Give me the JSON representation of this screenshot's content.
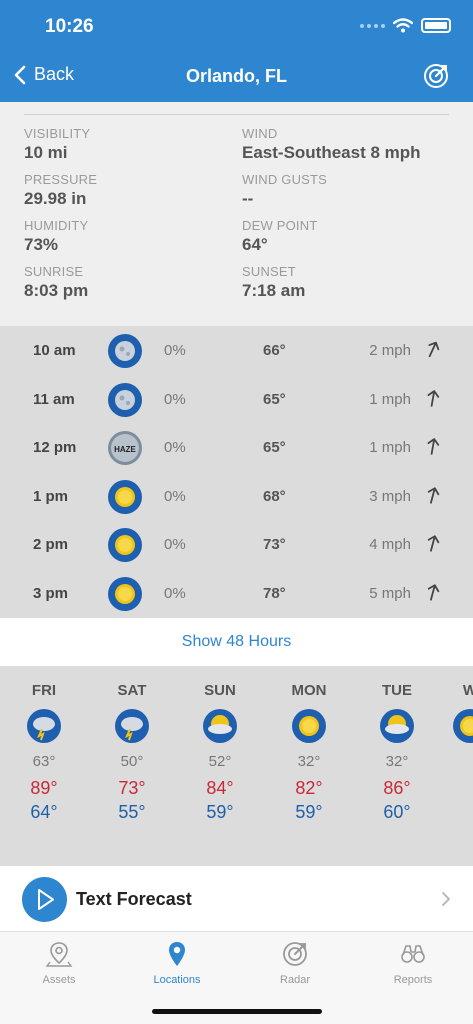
{
  "status_bar": {
    "time": "10:26"
  },
  "nav": {
    "back_label": "Back",
    "title": "Orlando, FL",
    "radar_icon": "radar-icon"
  },
  "details": {
    "visibility": {
      "label": "VISIBILITY",
      "value": "10 mi"
    },
    "wind": {
      "label": "WIND",
      "value": "East-Southeast 8 mph"
    },
    "pressure": {
      "label": "PRESSURE",
      "value": "29.98 in"
    },
    "wind_gusts": {
      "label": "WIND GUSTS",
      "value": "--"
    },
    "humidity": {
      "label": "HUMIDITY",
      "value": "73%"
    },
    "dew_point": {
      "label": "DEW POINT",
      "value": "64°"
    },
    "sunrise": {
      "label": "SUNRISE",
      "value": "8:03 pm"
    },
    "sunset": {
      "label": "SUNSET",
      "value": "7:18 am"
    }
  },
  "hourly": [
    {
      "time": "10 am",
      "icon": "night-clear-icon",
      "precip": "0%",
      "temp": "66°",
      "wind": "2 mph"
    },
    {
      "time": "11 am",
      "icon": "night-clear-icon",
      "precip": "0%",
      "temp": "65°",
      "wind": "1 mph"
    },
    {
      "time": "12 pm",
      "icon": "haze-icon",
      "icon_text": "HAZE",
      "precip": "0%",
      "temp": "65°",
      "wind": "1 mph"
    },
    {
      "time": "1 pm",
      "icon": "sunny-icon",
      "precip": "0%",
      "temp": "68°",
      "wind": "3 mph"
    },
    {
      "time": "2 pm",
      "icon": "sunny-icon",
      "precip": "0%",
      "temp": "73°",
      "wind": "4 mph"
    },
    {
      "time": "3 pm",
      "icon": "sunny-icon",
      "precip": "0%",
      "temp": "78°",
      "wind": "5 mph"
    }
  ],
  "show_more": {
    "label": "Show 48 Hours"
  },
  "daily": [
    {
      "day": "FRI",
      "icon": "thunderstorm-icon",
      "precip": "63°",
      "high": "89°",
      "low": "64°"
    },
    {
      "day": "SAT",
      "icon": "thunderstorm-icon",
      "precip": "50°",
      "high": "73°",
      "low": "55°"
    },
    {
      "day": "SUN",
      "icon": "partly-sunny-icon",
      "precip": "52°",
      "high": "84°",
      "low": "59°"
    },
    {
      "day": "MON",
      "icon": "sunny-icon",
      "precip": "32°",
      "high": "82°",
      "low": "59°"
    },
    {
      "day": "TUE",
      "icon": "partly-sunny-icon",
      "precip": "32°",
      "high": "86°",
      "low": "60°"
    },
    {
      "day": "W",
      "icon": "sunny-icon",
      "precip": "",
      "high": "",
      "low": ""
    }
  ],
  "text_forecast": {
    "label": "Text Forecast"
  },
  "tabs": [
    {
      "label": "Assets",
      "icon": "map-pin-outline-icon",
      "active": false
    },
    {
      "label": "Locations",
      "icon": "location-pin-icon",
      "active": true
    },
    {
      "label": "Radar",
      "icon": "radar-icon",
      "active": false
    },
    {
      "label": "Reports",
      "icon": "binoculars-icon",
      "active": false
    }
  ],
  "colors": {
    "accent": "#2f86d0",
    "high_temp": "#c8283a",
    "low_temp": "#2060a8"
  }
}
